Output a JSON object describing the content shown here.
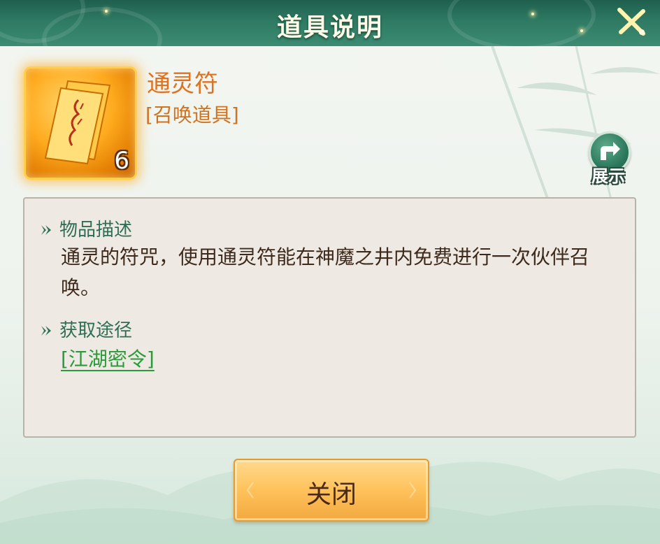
{
  "header": {
    "title": "道具说明",
    "close_icon": "close-x-icon",
    "accent": "#2e7a63"
  },
  "item": {
    "icon": "talisman-paper-icon",
    "name": "通灵符",
    "type": "[召唤道具]",
    "count": "6",
    "name_color": "#e0711e"
  },
  "share": {
    "icon": "share-arrow-icon",
    "label": "展示"
  },
  "sections": {
    "description": {
      "heading": "物品描述",
      "text": "通灵的符咒，使用通灵符能在神魔之井内免费进行一次伙伴召唤。"
    },
    "source": {
      "heading": "获取途径",
      "link": "[江湖密令]"
    }
  },
  "footer": {
    "close_label": "关闭"
  }
}
